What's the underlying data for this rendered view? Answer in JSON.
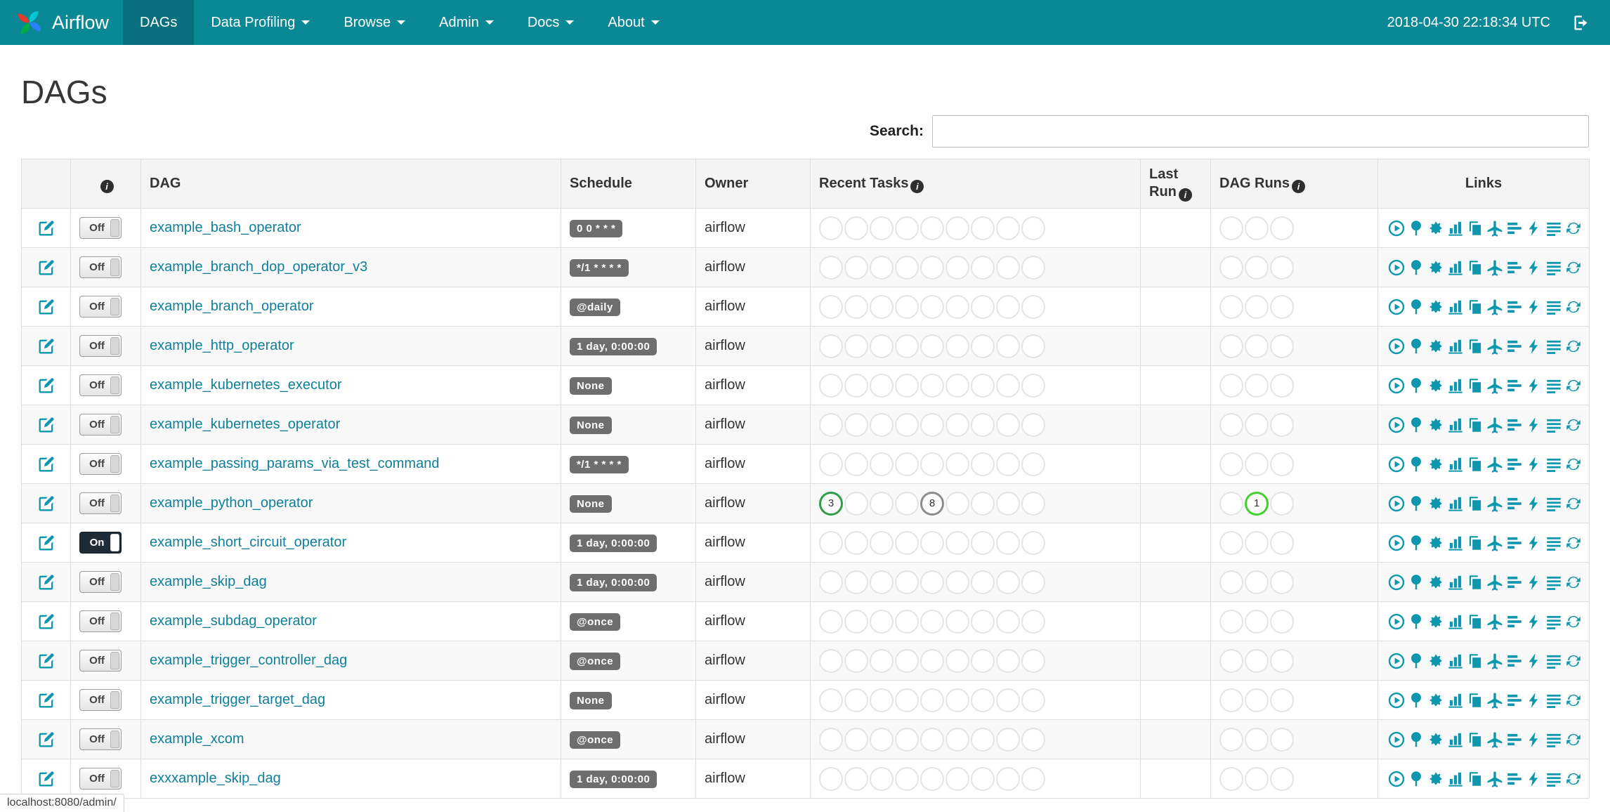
{
  "navbar": {
    "brand": "Airflow",
    "items": [
      {
        "label": "DAGs",
        "active": true,
        "caret": false
      },
      {
        "label": "Data Profiling",
        "active": false,
        "caret": true
      },
      {
        "label": "Browse",
        "active": false,
        "caret": true
      },
      {
        "label": "Admin",
        "active": false,
        "caret": true
      },
      {
        "label": "Docs",
        "active": false,
        "caret": true
      },
      {
        "label": "About",
        "active": false,
        "caret": true
      }
    ],
    "clock": "2018-04-30 22:18:34 UTC"
  },
  "page": {
    "title": "DAGs",
    "search_label": "Search:"
  },
  "table": {
    "headers": {
      "dag": "DAG",
      "schedule": "Schedule",
      "owner": "Owner",
      "recent_tasks": "Recent Tasks",
      "last_run_line1": "Last",
      "last_run_line2": "Run",
      "dag_runs": "DAG Runs",
      "links": "Links"
    },
    "toggle_labels": {
      "on": "On",
      "off": "Off"
    },
    "recent_task_slots": 9,
    "dag_run_slots": 3,
    "link_icons": [
      "trigger-dag-icon",
      "tree-view-icon",
      "graph-view-icon",
      "task-duration-icon",
      "task-tries-icon",
      "landing-times-icon",
      "gantt-icon",
      "code-icon",
      "log-icon",
      "refresh-icon"
    ],
    "rows": [
      {
        "dag": "example_bash_operator",
        "schedule": "0 0 * * *",
        "owner": "airflow",
        "enabled": false
      },
      {
        "dag": "example_branch_dop_operator_v3",
        "schedule": "*/1 * * * *",
        "owner": "airflow",
        "enabled": false
      },
      {
        "dag": "example_branch_operator",
        "schedule": "@daily",
        "owner": "airflow",
        "enabled": false
      },
      {
        "dag": "example_http_operator",
        "schedule": "1 day, 0:00:00",
        "owner": "airflow",
        "enabled": false
      },
      {
        "dag": "example_kubernetes_executor",
        "schedule": "None",
        "owner": "airflow",
        "enabled": false
      },
      {
        "dag": "example_kubernetes_operator",
        "schedule": "None",
        "owner": "airflow",
        "enabled": false
      },
      {
        "dag": "example_passing_params_via_test_command",
        "schedule": "*/1 * * * *",
        "owner": "airflow",
        "enabled": false
      },
      {
        "dag": "example_python_operator",
        "schedule": "None",
        "owner": "airflow",
        "enabled": false,
        "recent_tasks": [
          {
            "slot": 0,
            "count": 3,
            "color": "#2f9e44"
          },
          {
            "slot": 4,
            "count": 8,
            "color": "#8d8d8d"
          }
        ],
        "dag_runs": [
          {
            "slot": 1,
            "count": 1,
            "color": "#43cf2f"
          }
        ]
      },
      {
        "dag": "example_short_circuit_operator",
        "schedule": "1 day, 0:00:00",
        "owner": "airflow",
        "enabled": true
      },
      {
        "dag": "example_skip_dag",
        "schedule": "1 day, 0:00:00",
        "owner": "airflow",
        "enabled": false
      },
      {
        "dag": "example_subdag_operator",
        "schedule": "@once",
        "owner": "airflow",
        "enabled": false
      },
      {
        "dag": "example_trigger_controller_dag",
        "schedule": "@once",
        "owner": "airflow",
        "enabled": false
      },
      {
        "dag": "example_trigger_target_dag",
        "schedule": "None",
        "owner": "airflow",
        "enabled": false
      },
      {
        "dag": "example_xcom",
        "schedule": "@once",
        "owner": "airflow",
        "enabled": false
      },
      {
        "dag": "exxxample_skip_dag",
        "schedule": "1 day, 0:00:00",
        "owner": "airflow",
        "enabled": false
      }
    ]
  },
  "status_bar": {
    "text": "localhost:8080/admin/"
  },
  "colors": {
    "navbar": "#0b8895",
    "navbar_active": "#07707c",
    "accent": "#0d96ae",
    "link": "#0e7f9b",
    "success_green": "#2f9e44",
    "none_grey": "#8d8d8d",
    "run_green": "#43cf2f"
  }
}
